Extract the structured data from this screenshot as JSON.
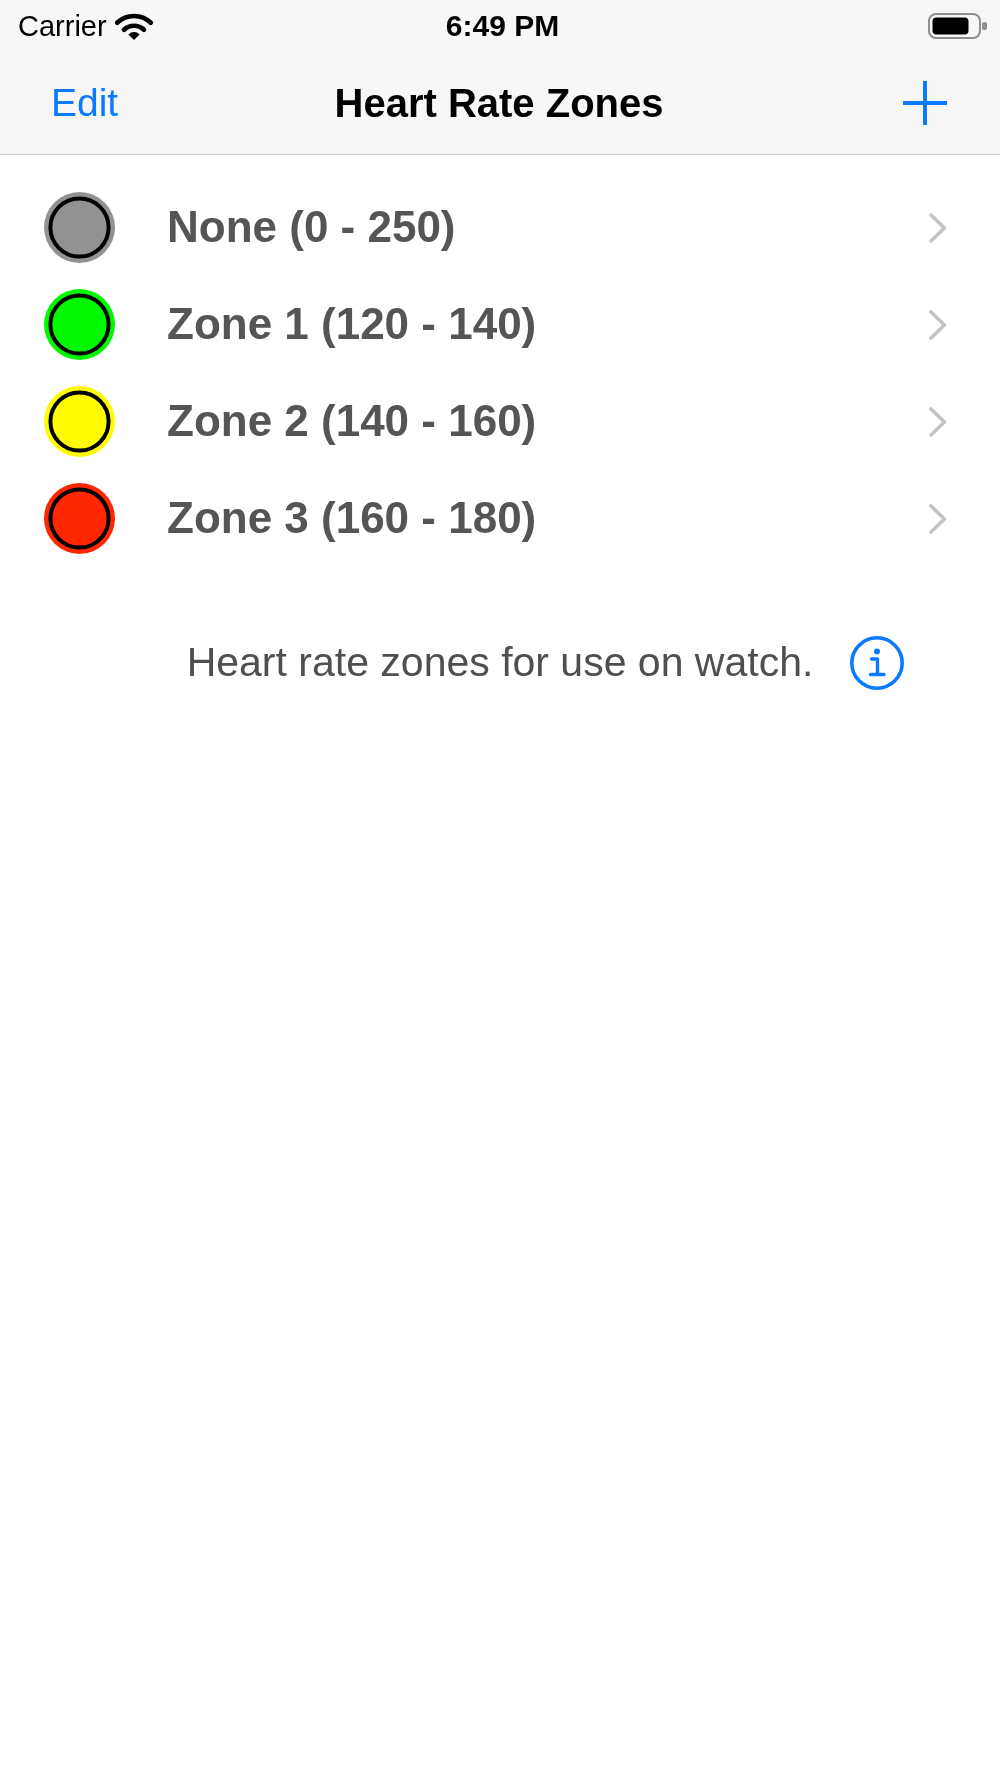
{
  "status_bar": {
    "carrier": "Carrier",
    "time": "6:49 PM"
  },
  "nav_bar": {
    "left_button": "Edit",
    "title": "Heart Rate Zones"
  },
  "zones": [
    {
      "label": "None (0 - 250)",
      "color": "#929292"
    },
    {
      "label": "Zone 1 (120 - 140)",
      "color": "#00f900"
    },
    {
      "label": "Zone 2 (140 - 160)",
      "color": "#fffb00"
    },
    {
      "label": "Zone 3 (160 - 180)",
      "color": "#ff2600"
    }
  ],
  "footer": {
    "text": "Heart rate zones for use on watch."
  }
}
